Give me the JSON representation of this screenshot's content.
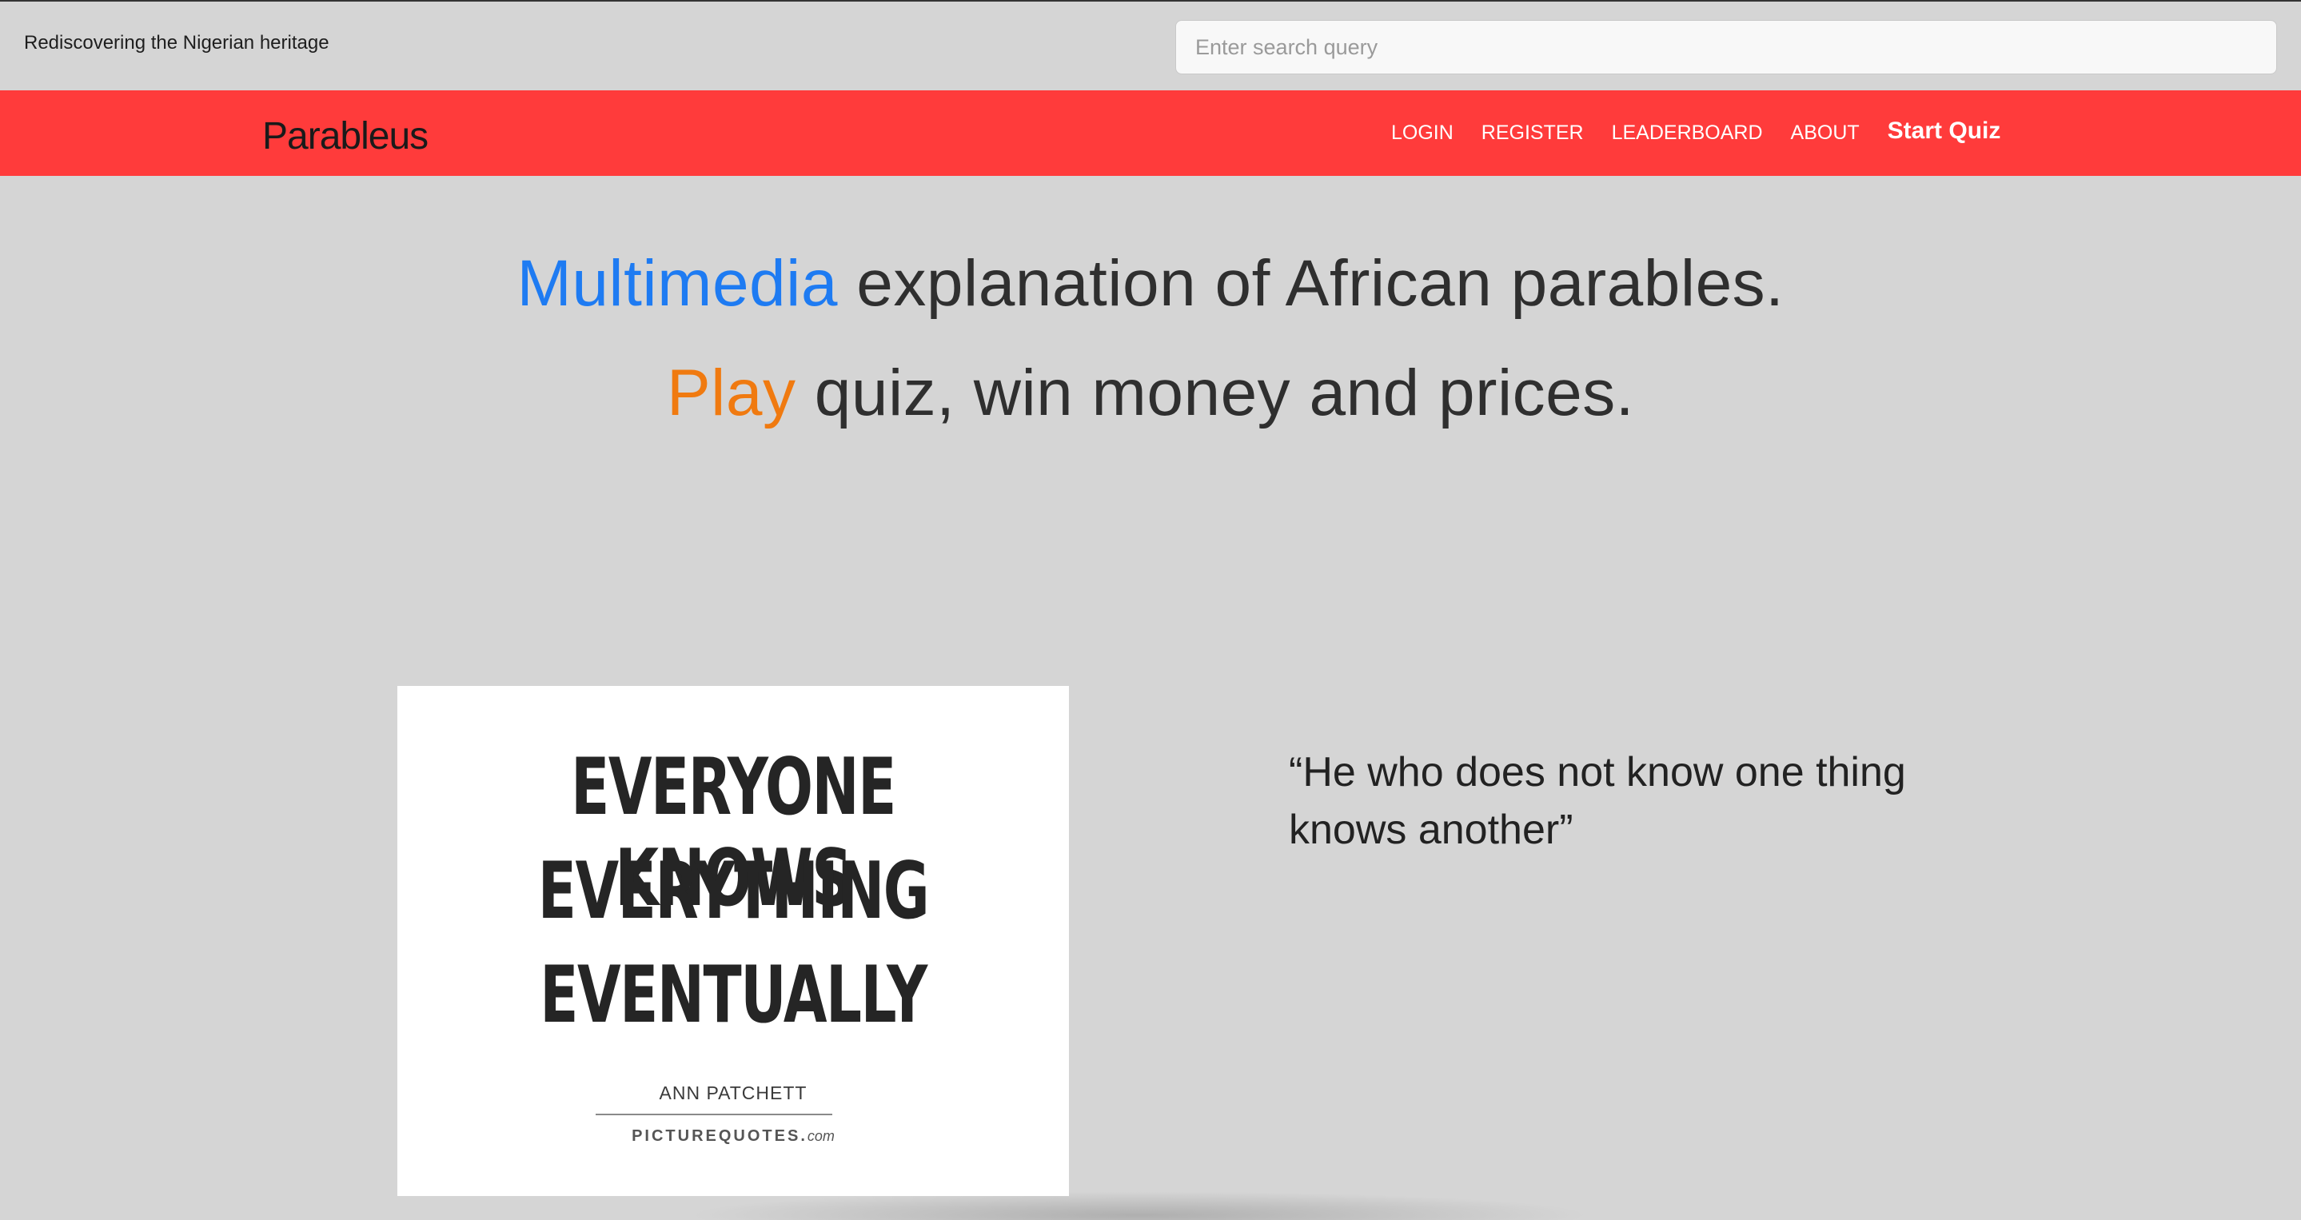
{
  "header": {
    "tagline": "Rediscovering the Nigerian heritage",
    "search_placeholder": "Enter search query"
  },
  "navbar": {
    "brand": "Parableus",
    "links": [
      "LOGIN",
      "REGISTER",
      "LEADERBOARD",
      "ABOUT"
    ],
    "cta": "Start Quiz",
    "background_color": "#ff3b3b"
  },
  "hero": {
    "line1_highlight": "Multimedia",
    "line1_rest": " explanation of African parables.",
    "line2_highlight": "Play",
    "line2_rest": " quiz, win money and prices.",
    "highlight_colors": {
      "line1": "#1e7bf2",
      "line2": "#f07a10"
    }
  },
  "featured": {
    "image": {
      "lines": [
        "EVERYONE KNOWS",
        "EVERYTHING",
        "EVENTUALLY"
      ],
      "author": "ANN PATCHETT",
      "site": "PICTUREQUOTES.",
      "site_suffix": "com"
    },
    "parable": "“He who does not know one thing knows another”"
  }
}
